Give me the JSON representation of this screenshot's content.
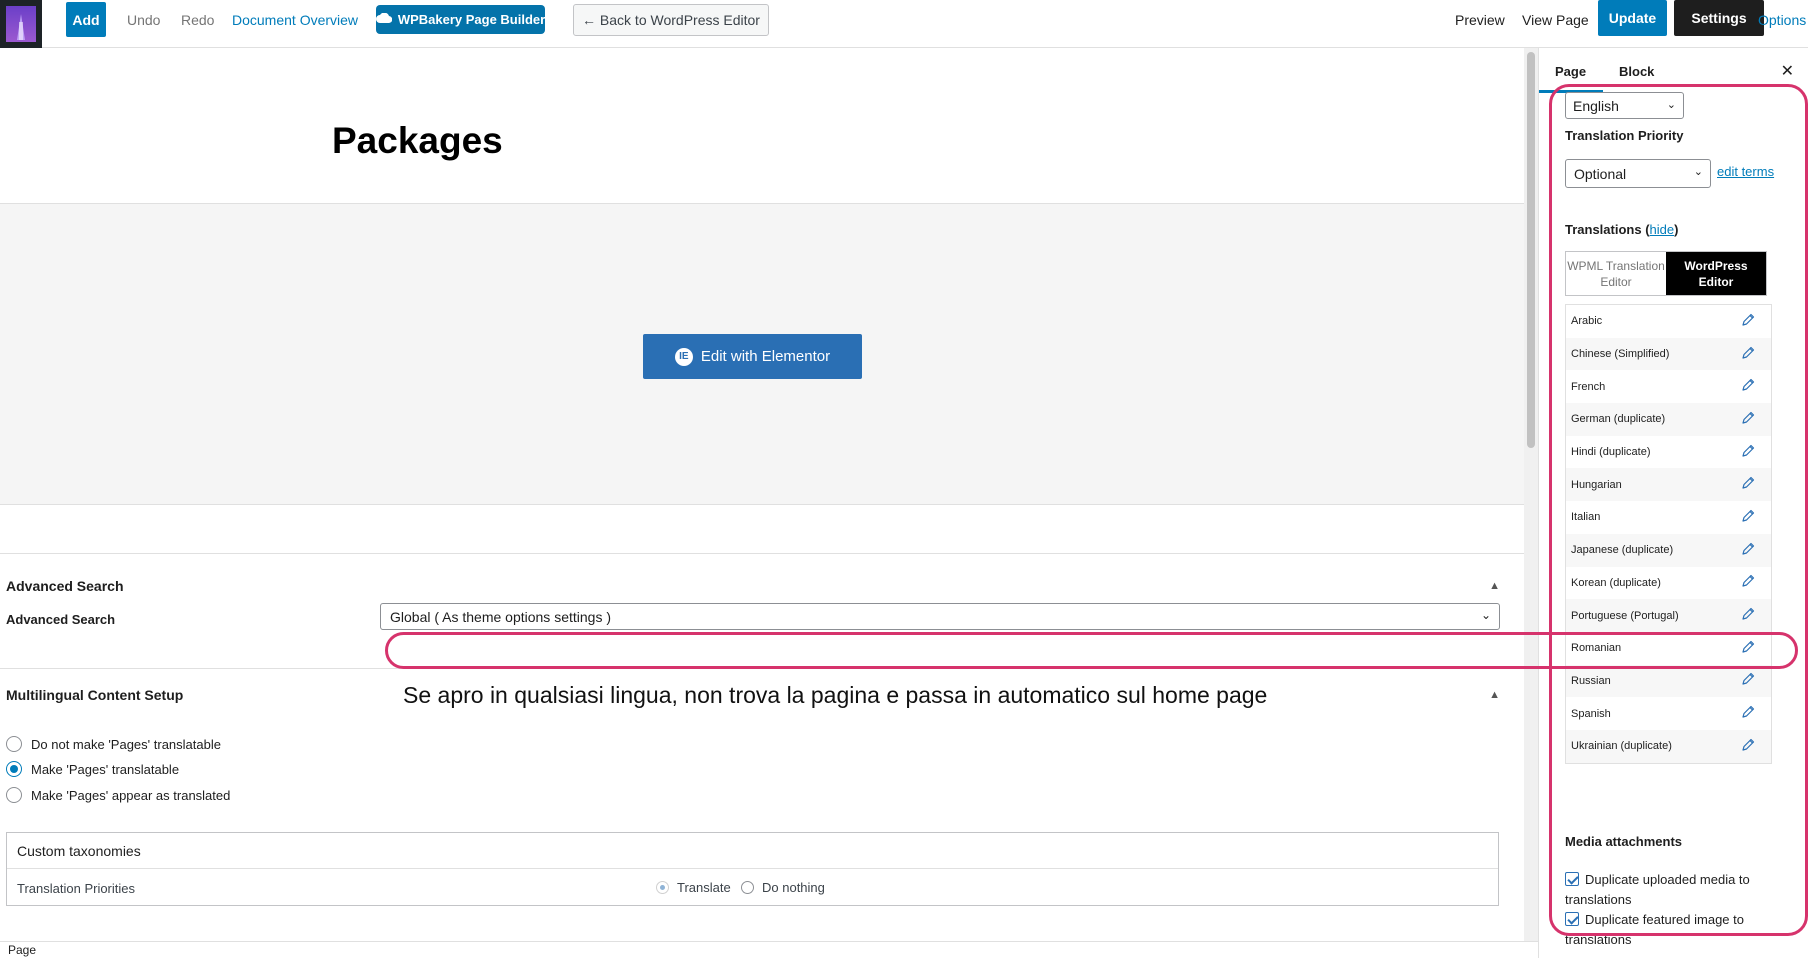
{
  "toolbar": {
    "add": "Add",
    "undo": "Undo",
    "redo": "Redo",
    "document_overview": "Document Overview",
    "wpbakery": "WPBakery Page Builder",
    "back": "← Back to WordPress Editor",
    "preview": "Preview",
    "view_page": "View Page",
    "update": "Update",
    "settings": "Settings",
    "options": "Options"
  },
  "editor": {
    "title": "Packages",
    "elementor_button": "Edit with Elementor"
  },
  "advanced_search": {
    "panel_title": "Advanced Search",
    "field_label": "Advanced Search",
    "selected": "Global ( As theme options settings )"
  },
  "multilingual": {
    "panel_title": "Multilingual Content Setup",
    "options": [
      "Do not make 'Pages' translatable",
      "Make 'Pages' translatable",
      "Make 'Pages' appear as translated"
    ],
    "selected_index": 1,
    "custom_taxonomies": {
      "title": "Custom taxonomies",
      "row_label": "Translation Priorities",
      "opt_translate": "Translate",
      "opt_do_nothing": "Do nothing"
    }
  },
  "annotation": "Se apro in qualsiasi lingua, non trova la pagina e passa in automatico sul home page",
  "footer": "Page",
  "sidebar": {
    "tab_page": "Page",
    "tab_block": "Block",
    "close": "✕",
    "language": "English",
    "priority_label": "Translation Priority",
    "priority_value": "Optional",
    "edit_terms": "edit terms",
    "translations_label": "Translations",
    "hide": "hide",
    "switch_wpml": "WPML Translation Editor",
    "switch_wp": "WordPress Editor",
    "languages": [
      "Arabic",
      "Chinese (Simplified)",
      "French",
      "German (duplicate)",
      "Hindi (duplicate)",
      "Hungarian",
      "Italian",
      "Japanese (duplicate)",
      "Korean (duplicate)",
      "Portuguese (Portugal)",
      "Romanian",
      "Russian",
      "Spanish",
      "Ukrainian (duplicate)"
    ],
    "media_label": "Media attachments",
    "cb_media": "Duplicate uploaded media to translations",
    "cb_featured": "Duplicate featured image to translations"
  },
  "colors": {
    "accent": "#007cba",
    "annotation": "#d6336c"
  }
}
